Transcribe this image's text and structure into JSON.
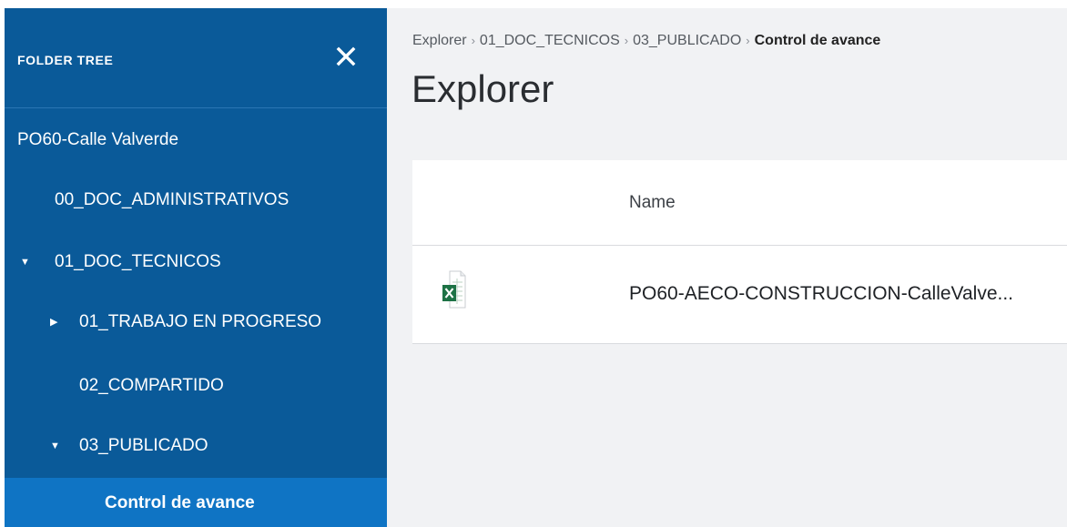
{
  "sidebar": {
    "title": "FOLDER TREE",
    "close_icon": "close-icon",
    "items": [
      {
        "label": "PO60-Calle Valverde",
        "caret": ""
      },
      {
        "label": "00_DOC_ADMINISTRATIVOS",
        "caret": ""
      },
      {
        "label": "01_DOC_TECNICOS",
        "caret": "▼"
      },
      {
        "label": "01_TRABAJO EN PROGRESO",
        "caret": "▶"
      },
      {
        "label": "02_COMPARTIDO",
        "caret": ""
      },
      {
        "label": "03_PUBLICADO",
        "caret": "▼"
      },
      {
        "label": "Control de avance",
        "caret": "",
        "selected": true
      }
    ]
  },
  "breadcrumb": {
    "items": [
      "Explorer",
      "01_DOC_TECNICOS",
      "03_PUBLICADO"
    ],
    "current": "Control de avance",
    "separator": "›"
  },
  "main": {
    "title": "Explorer",
    "table": {
      "columns": [
        "Name"
      ],
      "rows": [
        {
          "icon": "excel-file-icon",
          "name": "PO60-AECO-CONSTRUCCION-CalleValve..."
        }
      ]
    }
  },
  "colors": {
    "sidebar_bg": "#0a5a99",
    "selected_bg": "#0f74c4",
    "excel_green": "#1d7245"
  }
}
